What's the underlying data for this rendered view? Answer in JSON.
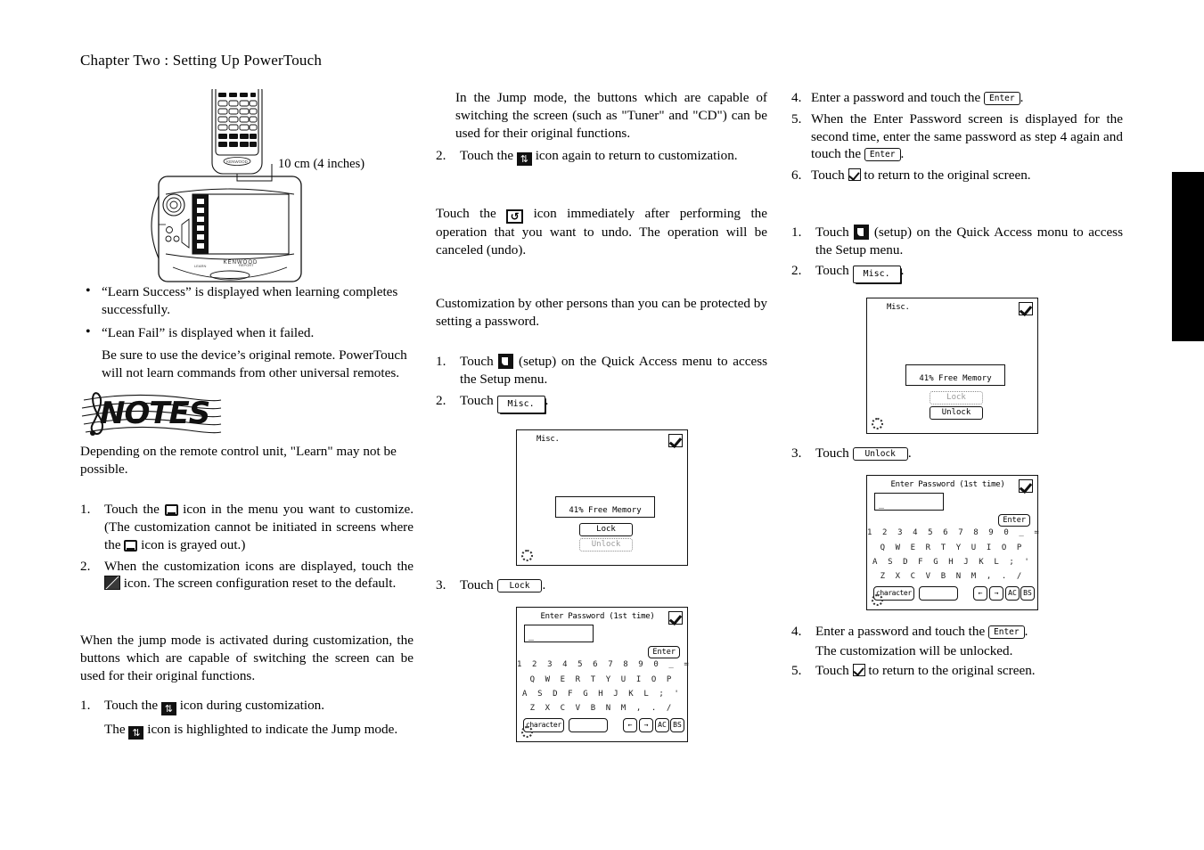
{
  "header": {
    "chapter_title": "Chapter Two : Setting Up PowerTouch"
  },
  "illustration": {
    "distance_label": "10 cm (4 inches)",
    "brand": "KENWOOD"
  },
  "notes_logo": {
    "word": "NOTES"
  },
  "column1": {
    "bullets": [
      "“Learn Success” is displayed when learning completes successfully.",
      "“Lean Fail” is displayed when it failed."
    ],
    "note_after_bullets": "Be sure to use the device’s original remote. PowerTouch will not learn commands from other universal remotes.",
    "notes_body": "Depending on the remote control unit, \"Learn\" may not be possible.",
    "steps": [
      {
        "num": "1.",
        "part_a": "Touch the",
        "part_b": "icon in the menu you want to customize. (The customization cannot be initiated in screens where the",
        "part_c": "icon is grayed out.)"
      },
      {
        "num": "2.",
        "part_a": "When the customization icons are displayed, touch the",
        "part_b": "icon. The screen configuration reset to the default."
      }
    ],
    "jump_intro": "When the jump mode is activated during customization, the buttons which are capable of switching the screen can be used for their original functions.",
    "jump_step": {
      "num": "1.",
      "part_a": "Touch the",
      "part_b": "icon during customization."
    },
    "jump_sub": {
      "part_a": "The",
      "part_b": "icon is highlighted to indicate the Jump mode."
    }
  },
  "column2": {
    "jump_para": "In the Jump mode, the buttons which are capable of switching the screen (such as \"Tuner\" and \"CD\") can be used for their original functions.",
    "jump_step2": {
      "num": "2.",
      "part_a": "Touch the",
      "part_b": "icon again to return to customization."
    },
    "undo_para": {
      "part_a": "Touch the",
      "part_b": "icon immediately after performing the operation that you want to undo. The operation will be canceled (undo)."
    },
    "password_intro": "Customization by other persons than you can be protected by setting a password.",
    "steps": [
      {
        "num": "1.",
        "part_a": "Touch",
        "part_b": "(setup) on the Quick Access menu to access the Setup menu."
      },
      {
        "num": "2.",
        "part_a": "Touch",
        "button": "Misc.",
        "part_c": "."
      }
    ],
    "misc_screen": {
      "title": "Misc.",
      "memory": "41% Free Memory",
      "btn_lock": "Lock",
      "btn_unlock": "Unlock",
      "lock_state": "lock-active"
    },
    "step3": {
      "num": "3.",
      "part_a": "Touch",
      "button": "Lock",
      "part_c": "."
    },
    "kbd_screen": {
      "title": "Enter Password (1st time)",
      "field_value": "_",
      "enter_label": "Enter",
      "row1": "1 2 3 4 5 6 7 8 9 0 _ =",
      "row2": "Q W E R T Y U I O P",
      "row3": "A S D F G H J K L ; '",
      "row4": "Z X C V B N M , . /",
      "key_character": "character",
      "key_left": "←",
      "key_right": "→",
      "key_ac": "AC",
      "key_bs": "BS"
    }
  },
  "column3": {
    "steps_lock": [
      {
        "num": "4.",
        "part_a": "Enter a password and touch the",
        "button": "Enter",
        "part_c": "."
      },
      {
        "num": "5.",
        "part_a": "When the Enter Password screen is displayed for the second time, enter the same password as step 4 again and touch the",
        "button": "Enter",
        "part_c": "."
      },
      {
        "num": "6.",
        "part_a": "Touch",
        "part_b": "to return to the original screen."
      }
    ],
    "steps_unlock": [
      {
        "num": "1.",
        "part_a": "Touch",
        "part_b": "(setup) on the Quick Access monu to access the Setup menu."
      },
      {
        "num": "2.",
        "part_a": "Touch",
        "button": "Misc.",
        "part_c": "."
      }
    ],
    "misc_screen": {
      "title": "Misc.",
      "memory": "41% Free Memory",
      "btn_lock": "Lock",
      "btn_unlock": "Unlock",
      "lock_state": "unlock-active"
    },
    "step3": {
      "num": "3.",
      "part_a": "Touch",
      "button": "Unlock",
      "part_c": "."
    },
    "kbd_screen": {
      "title": "Enter Password (1st time)",
      "field_value": "_",
      "enter_label": "Enter",
      "row1": "1 2 3 4 5 6 7 8 9 0 _ =",
      "row2": "Q W E R T Y U I O P",
      "row3": "A S D F G H J K L ; '",
      "row4": "Z X C V B N M , . /",
      "key_character": "character",
      "key_left": "←",
      "key_right": "→",
      "key_ac": "AC",
      "key_bs": "BS"
    },
    "steps_tail": [
      {
        "num": "4.",
        "part_a": "Enter a password and touch the",
        "button": "Enter",
        "part_c": ".",
        "sub": "The customization will be unlocked."
      },
      {
        "num": "5.",
        "part_a": "Touch",
        "part_b": "to return to the original screen."
      }
    ]
  }
}
